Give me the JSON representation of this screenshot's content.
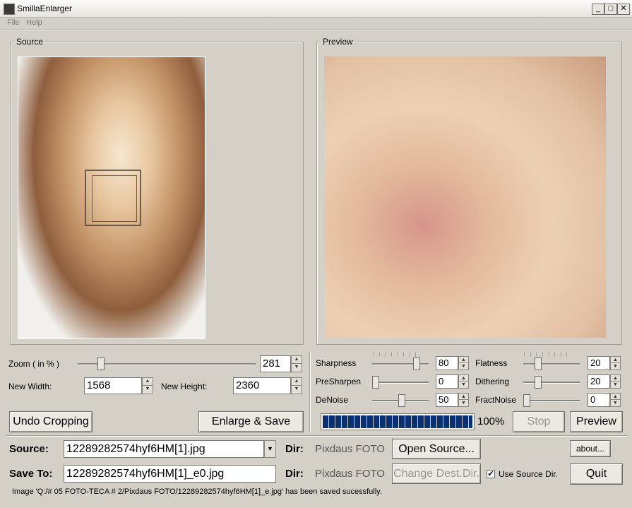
{
  "window": {
    "title": "SmillaEnlarger"
  },
  "menu": [
    "File",
    "Help"
  ],
  "source_panel": {
    "legend": "Source"
  },
  "preview_panel": {
    "legend": "Preview"
  },
  "zoom": {
    "label": "Zoom ( in % )",
    "value": "281",
    "slider_fraction": 0.11
  },
  "new_width": {
    "label": "New Width:",
    "value": "1568"
  },
  "new_height": {
    "label": "New Height:",
    "value": "2360"
  },
  "buttons": {
    "undo_cropping": "Undo Cropping",
    "enlarge_save": "Enlarge & Save",
    "stop": "Stop",
    "preview": "Preview",
    "open_source": "Open Source...",
    "change_dest": "Change Dest.Dir.",
    "about": "about...",
    "quit": "Quit"
  },
  "params": [
    {
      "label": "Sharpness",
      "value": "80"
    },
    {
      "label": "PreSharpen",
      "value": "0"
    },
    {
      "label": "DeNoise",
      "value": "50"
    },
    {
      "label": "Flatness",
      "value": "20"
    },
    {
      "label": "Dithering",
      "value": "20"
    },
    {
      "label": "FractNoise",
      "value": "0"
    }
  ],
  "progress": {
    "percent_label": "100%",
    "value": 1.0
  },
  "source_file": {
    "label": "Source:",
    "value": "12289282574hyf6HM[1].jpg"
  },
  "save_to": {
    "label": "Save To:",
    "value": "12289282574hyf6HM[1]_e0.jpg"
  },
  "dir": {
    "label": "Dir:",
    "value": "Pixdaus FOTO"
  },
  "use_source_dir": {
    "label": "Use Source Dir.",
    "checked": true
  },
  "status": "Image 'Q:/#  05  FOTO-TECA # 2/Pixdaus FOTO/12289282574hyf6HM[1]_e.jpg' has been saved sucessfully."
}
